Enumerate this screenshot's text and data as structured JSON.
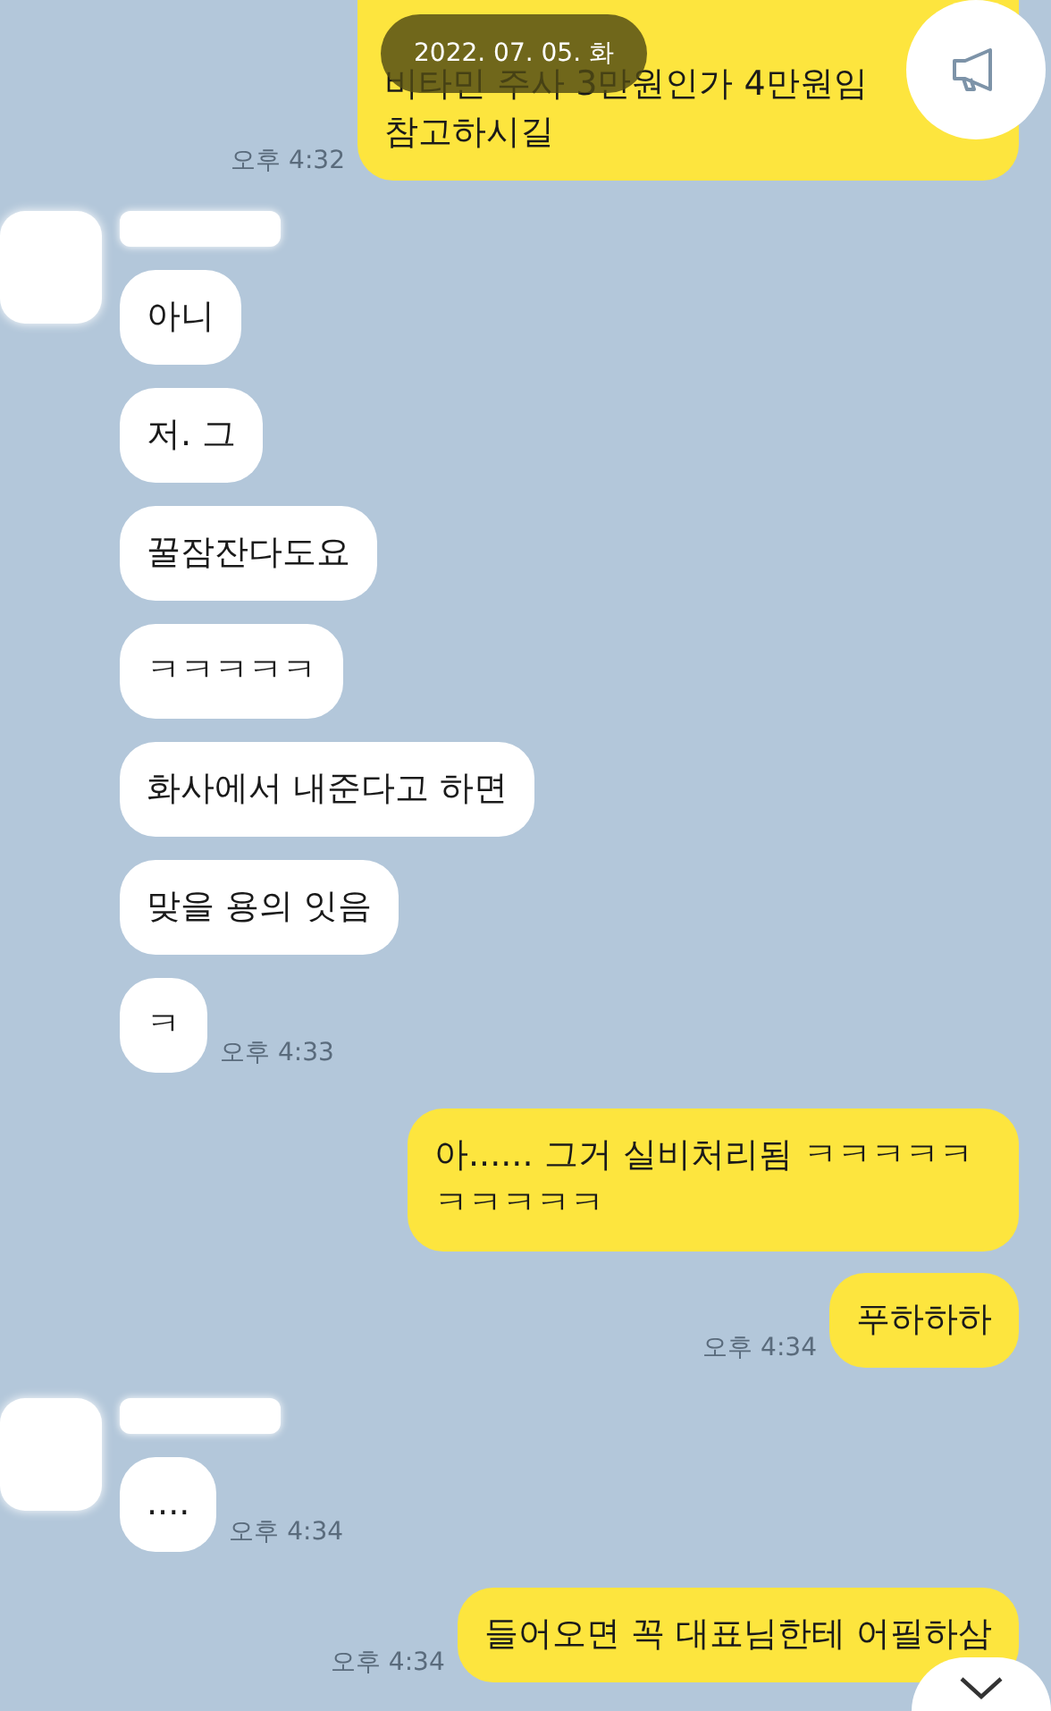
{
  "date_badge": "2022. 07. 05. 화",
  "groups": [
    {
      "kind": "me",
      "messages": [
        "비타민 주사 3만원인가 4만원임\n참고하시길"
      ],
      "time": "오후 4:32"
    },
    {
      "kind": "friend",
      "messages": [
        "아니",
        "저. 그",
        "꿀잠잔다도요",
        "ㅋㅋㅋㅋㅋ",
        "화사에서 내준다고 하면",
        "맞을 용의 잇음",
        "ㅋ"
      ],
      "time": "오후 4:33"
    },
    {
      "kind": "me",
      "messages": [
        "아...... 그거 실비처리됨 ㅋㅋㅋㅋㅋㅋㅋㅋㅋㅋ",
        "푸하하하"
      ],
      "time": "오후 4:34"
    },
    {
      "kind": "friend",
      "messages": [
        "...."
      ],
      "time": "오후 4:34"
    },
    {
      "kind": "me",
      "messages": [
        "들어오면 꼭 대표님한테 어필하삼"
      ],
      "time": "오후 4:34"
    }
  ]
}
